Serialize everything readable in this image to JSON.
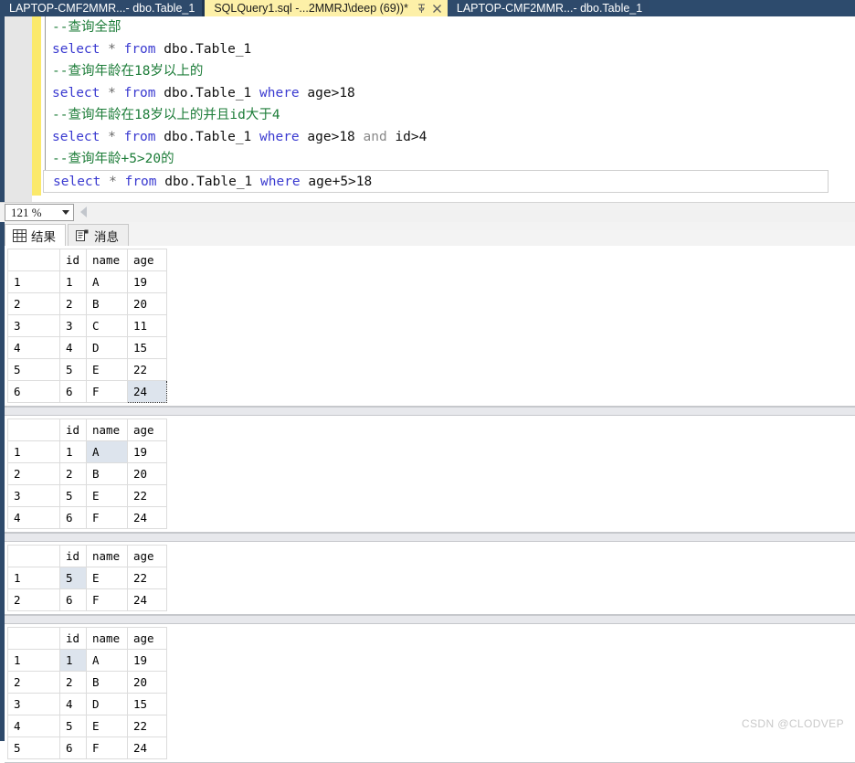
{
  "window": {
    "tabs": [
      {
        "label": "LAPTOP-CMF2MMR...- dbo.Table_1",
        "state": "inactive"
      },
      {
        "label": "SQLQuery1.sql -...2MMRJ\\deep (69))*",
        "state": "active"
      },
      {
        "label": "LAPTOP-CMF2MMR...- dbo.Table_1",
        "state": "inactive"
      }
    ],
    "tab_icons": {
      "pin": "pin-icon",
      "close": "close-icon"
    },
    "colors": {
      "tab_active_bg": "#fdf0a8",
      "tab_inactive_bg": "#2e4a6b",
      "strip_bg": "#2d4b6d",
      "change_bar": "#fbe96b",
      "selection": "#dde4ed"
    }
  },
  "editor": {
    "lines": [
      {
        "type": "comment",
        "text": "--查询全部"
      },
      {
        "type": "sql",
        "tokens": [
          {
            "t": "select",
            "c": "keyword"
          },
          {
            "t": " * ",
            "c": "op"
          },
          {
            "t": "from",
            "c": "keyword"
          },
          {
            "t": " dbo.Table_1",
            "c": "plain"
          }
        ]
      },
      {
        "type": "comment",
        "text": "--查询年龄在18岁以上的"
      },
      {
        "type": "sql",
        "tokens": [
          {
            "t": "select",
            "c": "keyword"
          },
          {
            "t": " * ",
            "c": "op"
          },
          {
            "t": "from",
            "c": "keyword"
          },
          {
            "t": " dbo.Table_1 ",
            "c": "plain"
          },
          {
            "t": "where",
            "c": "keyword"
          },
          {
            "t": " age>18",
            "c": "plain"
          }
        ]
      },
      {
        "type": "comment",
        "text": "--查询年龄在18岁以上的并且id大于4"
      },
      {
        "type": "sql",
        "tokens": [
          {
            "t": "select",
            "c": "keyword"
          },
          {
            "t": " * ",
            "c": "op"
          },
          {
            "t": "from",
            "c": "keyword"
          },
          {
            "t": " dbo.Table_1 ",
            "c": "plain"
          },
          {
            "t": "where",
            "c": "keyword"
          },
          {
            "t": " age>18 ",
            "c": "plain"
          },
          {
            "t": "and",
            "c": "dim"
          },
          {
            "t": " id>4",
            "c": "plain"
          }
        ]
      },
      {
        "type": "comment",
        "text": "--查询年龄+5>20的"
      },
      {
        "type": "sql",
        "current": true,
        "tokens": [
          {
            "t": "select",
            "c": "keyword"
          },
          {
            "t": " * ",
            "c": "op"
          },
          {
            "t": "from",
            "c": "keyword"
          },
          {
            "t": " dbo.Table_1 ",
            "c": "plain"
          },
          {
            "t": "where",
            "c": "keyword"
          },
          {
            "t": " age+5>18",
            "c": "plain"
          }
        ]
      }
    ]
  },
  "zoom_bar": {
    "zoom_value": "121 %",
    "scroll_left_icon": "scroll-left-arrow-icon"
  },
  "results": {
    "tabs": [
      {
        "label": "结果",
        "icon": "grid-icon",
        "state": "active"
      },
      {
        "label": "消息",
        "icon": "message-icon",
        "state": "inactive"
      }
    ],
    "columns": [
      "id",
      "name",
      "age"
    ],
    "grids": [
      {
        "rows": [
          {
            "n": "1",
            "id": "1",
            "name": "A",
            "age": "19"
          },
          {
            "n": "2",
            "id": "2",
            "name": "B",
            "age": "20"
          },
          {
            "n": "3",
            "id": "3",
            "name": "C",
            "age": "11"
          },
          {
            "n": "4",
            "id": "4",
            "name": "D",
            "age": "15"
          },
          {
            "n": "5",
            "id": "5",
            "name": "E",
            "age": "22"
          },
          {
            "n": "6",
            "id": "6",
            "name": "F",
            "age": "24"
          }
        ],
        "selected": {
          "row": 5,
          "col": "age"
        }
      },
      {
        "rows": [
          {
            "n": "1",
            "id": "1",
            "name": "A",
            "age": "19"
          },
          {
            "n": "2",
            "id": "2",
            "name": "B",
            "age": "20"
          },
          {
            "n": "3",
            "id": "5",
            "name": "E",
            "age": "22"
          },
          {
            "n": "4",
            "id": "6",
            "name": "F",
            "age": "24"
          }
        ],
        "selected": {
          "row": 0,
          "col": "name"
        }
      },
      {
        "rows": [
          {
            "n": "1",
            "id": "5",
            "name": "E",
            "age": "22"
          },
          {
            "n": "2",
            "id": "6",
            "name": "F",
            "age": "24"
          }
        ],
        "selected": {
          "row": 0,
          "col": "id"
        }
      },
      {
        "rows": [
          {
            "n": "1",
            "id": "1",
            "name": "A",
            "age": "19"
          },
          {
            "n": "2",
            "id": "2",
            "name": "B",
            "age": "20"
          },
          {
            "n": "3",
            "id": "4",
            "name": "D",
            "age": "15"
          },
          {
            "n": "4",
            "id": "5",
            "name": "E",
            "age": "22"
          },
          {
            "n": "5",
            "id": "6",
            "name": "F",
            "age": "24"
          }
        ],
        "selected": {
          "row": 0,
          "col": "id"
        }
      }
    ]
  },
  "watermark": {
    "text": "CSDN @CLODVEP"
  }
}
